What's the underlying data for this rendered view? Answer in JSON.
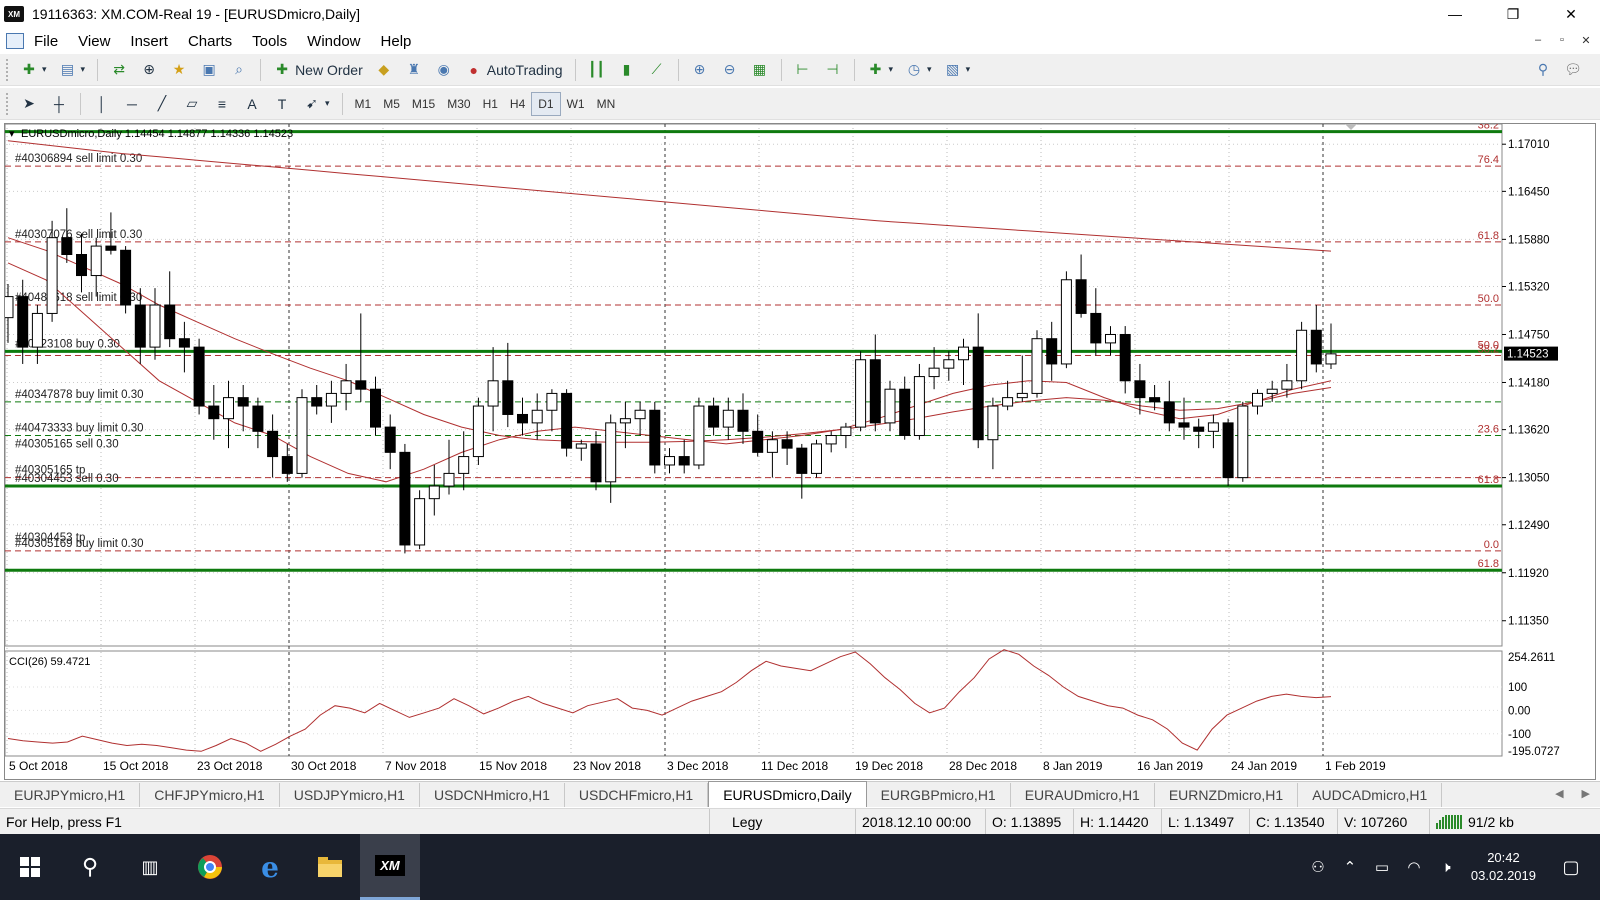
{
  "window": {
    "logo": "XM",
    "title": "19116363: XM.COM-Real 19 - [EURUSDmicro,Daily]",
    "minimize": "—",
    "maximize": "❐",
    "close": "✕"
  },
  "menu": {
    "items": [
      "File",
      "View",
      "Insert",
      "Charts",
      "Tools",
      "Window",
      "Help"
    ],
    "mdi": [
      "–",
      "▫",
      "✕"
    ]
  },
  "toolbar": {
    "new_order": "New Order",
    "autotrading": "AutoTrading",
    "timeframes": [
      "M1",
      "M5",
      "M15",
      "M30",
      "H1",
      "H4",
      "D1",
      "W1",
      "MN"
    ],
    "active_timeframe": "D1"
  },
  "chart": {
    "header": "EURUSDmicro,Daily  1.14454 1.14877 1.14336 1.14523",
    "price_ticks": [
      "1.17010",
      "1.16450",
      "1.15880",
      "1.15320",
      "1.14750",
      "1.14180",
      "1.13620",
      "1.13050",
      "1.12490",
      "1.11920",
      "1.11350"
    ],
    "current_price": "1.14523",
    "dates": [
      "5 Oct 2018",
      "15 Oct 2018",
      "23 Oct 2018",
      "30 Oct 2018",
      "7 Nov 2018",
      "15 Nov 2018",
      "23 Nov 2018",
      "3 Dec 2018",
      "11 Dec 2018",
      "19 Dec 2018",
      "28 Dec 2018",
      "8 Jan 2019",
      "16 Jan 2019",
      "24 Jan 2019",
      "1 Feb 2019"
    ],
    "fib_labels": [
      "38.2",
      "76.4",
      "61.8",
      "50.0",
      "50.0",
      "38.2",
      "23.6",
      "61.8",
      "0.0",
      "61.8"
    ],
    "order_labels": [
      "#40306894 sell limit 0.30",
      "#40307076 sell limit 0.30",
      "#40485618 sell limit 0.30",
      "#40523108 buy 0.30",
      "#40347878 buy limit 0.30",
      "#40473333 buy limit 0.30",
      "#40305165 sell 0.30",
      "#40305165 tp",
      "#40304453 sell 0.30",
      "#40304453 tp",
      "#40305169 buy limit 0.30"
    ],
    "cci_label": "CCI(26) 59.4721",
    "cci_ticks": [
      "254.2611",
      "100",
      "0.00",
      "-100",
      "-195.0727"
    ]
  },
  "chart_data": {
    "type": "candlestick",
    "title": "EURUSDmicro,Daily",
    "ylim": [
      1.1105,
      1.1725
    ],
    "ohlc": [
      [
        1.1495,
        1.1535,
        1.1465,
        1.152
      ],
      [
        1.152,
        1.154,
        1.144,
        1.146
      ],
      [
        1.146,
        1.151,
        1.144,
        1.15
      ],
      [
        1.15,
        1.161,
        1.149,
        1.159
      ],
      [
        1.159,
        1.1625,
        1.156,
        1.157
      ],
      [
        1.157,
        1.1595,
        1.1525,
        1.1545
      ],
      [
        1.1545,
        1.159,
        1.152,
        1.158
      ],
      [
        1.158,
        1.162,
        1.157,
        1.1575
      ],
      [
        1.1575,
        1.158,
        1.15,
        1.151
      ],
      [
        1.151,
        1.153,
        1.144,
        1.146
      ],
      [
        1.146,
        1.153,
        1.1445,
        1.151
      ],
      [
        1.151,
        1.155,
        1.146,
        1.147
      ],
      [
        1.147,
        1.149,
        1.143,
        1.146
      ],
      [
        1.146,
        1.147,
        1.138,
        1.139
      ],
      [
        1.139,
        1.1415,
        1.135,
        1.1375
      ],
      [
        1.1375,
        1.142,
        1.134,
        1.14
      ],
      [
        1.14,
        1.1415,
        1.136,
        1.139
      ],
      [
        1.139,
        1.14,
        1.134,
        1.136
      ],
      [
        1.136,
        1.138,
        1.1305,
        1.133
      ],
      [
        1.133,
        1.1345,
        1.13,
        1.131
      ],
      [
        1.131,
        1.141,
        1.1305,
        1.14
      ],
      [
        1.14,
        1.1415,
        1.138,
        1.139
      ],
      [
        1.139,
        1.142,
        1.137,
        1.1405
      ],
      [
        1.1405,
        1.144,
        1.1385,
        1.142
      ],
      [
        1.142,
        1.15,
        1.1395,
        1.141
      ],
      [
        1.141,
        1.1425,
        1.1355,
        1.1365
      ],
      [
        1.1365,
        1.138,
        1.1315,
        1.1335
      ],
      [
        1.1335,
        1.1345,
        1.1215,
        1.1225
      ],
      [
        1.1225,
        1.129,
        1.122,
        1.128
      ],
      [
        1.128,
        1.132,
        1.126,
        1.1295
      ],
      [
        1.1295,
        1.135,
        1.1285,
        1.131
      ],
      [
        1.131,
        1.136,
        1.129,
        1.133
      ],
      [
        1.133,
        1.14,
        1.132,
        1.139
      ],
      [
        1.139,
        1.146,
        1.136,
        1.142
      ],
      [
        1.142,
        1.1465,
        1.1365,
        1.138
      ],
      [
        1.138,
        1.14,
        1.1355,
        1.137
      ],
      [
        1.137,
        1.1405,
        1.135,
        1.1385
      ],
      [
        1.1385,
        1.141,
        1.136,
        1.1405
      ],
      [
        1.1405,
        1.141,
        1.133,
        1.134
      ],
      [
        1.134,
        1.135,
        1.1325,
        1.1345
      ],
      [
        1.1345,
        1.136,
        1.129,
        1.13
      ],
      [
        1.13,
        1.138,
        1.1275,
        1.137
      ],
      [
        1.137,
        1.1395,
        1.134,
        1.1375
      ],
      [
        1.1375,
        1.1395,
        1.1355,
        1.1385
      ],
      [
        1.1385,
        1.1395,
        1.131,
        1.132
      ],
      [
        1.132,
        1.134,
        1.131,
        1.133
      ],
      [
        1.133,
        1.135,
        1.131,
        1.132
      ],
      [
        1.132,
        1.14,
        1.1315,
        1.139
      ],
      [
        1.139,
        1.14,
        1.1355,
        1.1365
      ],
      [
        1.1365,
        1.14,
        1.135,
        1.1385
      ],
      [
        1.1385,
        1.1405,
        1.1345,
        1.136
      ],
      [
        1.136,
        1.138,
        1.133,
        1.1335
      ],
      [
        1.1335,
        1.136,
        1.1305,
        1.135
      ],
      [
        1.135,
        1.136,
        1.132,
        1.134
      ],
      [
        1.134,
        1.1345,
        1.128,
        1.131
      ],
      [
        1.131,
        1.135,
        1.1305,
        1.1345
      ],
      [
        1.1345,
        1.136,
        1.1335,
        1.1355
      ],
      [
        1.1355,
        1.137,
        1.134,
        1.1365
      ],
      [
        1.1365,
        1.1455,
        1.136,
        1.1445
      ],
      [
        1.1445,
        1.1475,
        1.136,
        1.137
      ],
      [
        1.137,
        1.142,
        1.136,
        1.141
      ],
      [
        1.141,
        1.1425,
        1.135,
        1.1355
      ],
      [
        1.1355,
        1.144,
        1.135,
        1.1425
      ],
      [
        1.1425,
        1.146,
        1.141,
        1.1435
      ],
      [
        1.1435,
        1.1455,
        1.142,
        1.1445
      ],
      [
        1.1445,
        1.147,
        1.1415,
        1.146
      ],
      [
        1.146,
        1.15,
        1.134,
        1.135
      ],
      [
        1.135,
        1.14,
        1.1315,
        1.139
      ],
      [
        1.139,
        1.142,
        1.1385,
        1.14
      ],
      [
        1.14,
        1.145,
        1.1395,
        1.1405
      ],
      [
        1.1405,
        1.148,
        1.14,
        1.147
      ],
      [
        1.147,
        1.149,
        1.142,
        1.144
      ],
      [
        1.144,
        1.155,
        1.1435,
        1.154
      ],
      [
        1.154,
        1.157,
        1.1495,
        1.15
      ],
      [
        1.15,
        1.153,
        1.145,
        1.1465
      ],
      [
        1.1465,
        1.1485,
        1.145,
        1.1475
      ],
      [
        1.1475,
        1.1485,
        1.1405,
        1.142
      ],
      [
        1.142,
        1.144,
        1.138,
        1.14
      ],
      [
        1.14,
        1.1415,
        1.1385,
        1.1395
      ],
      [
        1.1395,
        1.142,
        1.136,
        1.137
      ],
      [
        1.137,
        1.14,
        1.135,
        1.1365
      ],
      [
        1.1365,
        1.1375,
        1.134,
        1.136
      ],
      [
        1.136,
        1.138,
        1.134,
        1.137
      ],
      [
        1.137,
        1.1375,
        1.1295,
        1.1305
      ],
      [
        1.1305,
        1.1395,
        1.13,
        1.139
      ],
      [
        1.139,
        1.141,
        1.138,
        1.1405
      ],
      [
        1.1405,
        1.142,
        1.1395,
        1.141
      ],
      [
        1.141,
        1.144,
        1.14,
        1.142
      ],
      [
        1.142,
        1.149,
        1.141,
        1.148
      ],
      [
        1.148,
        1.151,
        1.143,
        1.144
      ],
      [
        1.144,
        1.1488,
        1.1434,
        1.1452
      ]
    ],
    "series": [
      {
        "name": "MA slow",
        "color": "#b03030",
        "values": [
          1.1705,
          1.17,
          1.1695,
          1.169,
          1.1686,
          1.1682,
          1.1678,
          1.1674,
          1.167,
          1.1666,
          1.1662,
          1.1658,
          1.1654,
          1.165,
          1.1646,
          1.1642,
          1.1638,
          1.1634,
          1.163,
          1.1626,
          1.1622,
          1.1618,
          1.1614,
          1.161,
          1.1607,
          1.1604,
          1.1601,
          1.1598,
          1.1595,
          1.1592,
          1.1589,
          1.1586,
          1.1583,
          1.158,
          1.1577,
          1.1574
        ]
      },
      {
        "name": "MA medium",
        "color": "#b03030",
        "values": [
          1.159,
          1.1575,
          1.1555,
          1.1535,
          1.151,
          1.149,
          1.147,
          1.1452,
          1.1435,
          1.142,
          1.14,
          1.138,
          1.1365,
          1.1355,
          1.135,
          1.1348,
          1.1347,
          1.1347,
          1.1348,
          1.135,
          1.1353,
          1.1357,
          1.1362,
          1.1368,
          1.1375,
          1.1383,
          1.139,
          1.1396,
          1.14,
          1.1397,
          1.139,
          1.1385,
          1.1387,
          1.1395,
          1.1405,
          1.1412
        ]
      },
      {
        "name": "MA fast",
        "color": "#b03030",
        "values": [
          1.156,
          1.154,
          1.15,
          1.146,
          1.142,
          1.1395,
          1.137,
          1.1355,
          1.133,
          1.131,
          1.13,
          1.1315,
          1.1335,
          1.135,
          1.136,
          1.1365,
          1.136,
          1.1355,
          1.135,
          1.1345,
          1.135,
          1.1355,
          1.1362,
          1.1375,
          1.139,
          1.1405,
          1.1415,
          1.142,
          1.1418,
          1.14,
          1.1385,
          1.1375,
          1.138,
          1.1395,
          1.141,
          1.142
        ]
      }
    ],
    "levels": [
      {
        "price": 1.1716,
        "color": "#0e7a0e",
        "fib": "38.2",
        "order": ""
      },
      {
        "price": 1.1675,
        "color": "#b03030",
        "fib": "76.4",
        "order": "#40306894 sell limit 0.30"
      },
      {
        "price": 1.1585,
        "color": "#b03030",
        "fib": "61.8",
        "order": "#40307076 sell limit 0.30"
      },
      {
        "price": 1.151,
        "color": "#b03030",
        "fib": "50.0",
        "order": "#40485618 sell limit 0.30"
      },
      {
        "price": 1.1455,
        "color": "#0e7a0e",
        "fib": "50.0",
        "order": "#40523108 buy 0.30"
      },
      {
        "price": 1.145,
        "color": "#b03030",
        "fib": "38.2",
        "order": ""
      },
      {
        "price": 1.1395,
        "color": "#0e7a0e",
        "fib": "",
        "order": "#40347878 buy limit 0.30"
      },
      {
        "price": 1.1355,
        "color": "#0e7a0e",
        "fib": "23.6",
        "order": "#40473333 buy limit 0.30"
      },
      {
        "price": 1.1305,
        "color": "#b03030",
        "fib": "",
        "order": "#40305165 tp"
      },
      {
        "price": 1.1295,
        "color": "#0e7a0e",
        "fib": "61.8",
        "order": "#40304453 sell 0.30"
      },
      {
        "price": 1.1218,
        "color": "#b03030",
        "fib": "0.0",
        "order": "#40305169 buy limit 0.30"
      },
      {
        "price": 1.1195,
        "color": "#0e7a0e",
        "fib": "61.8",
        "order": ""
      }
    ],
    "cci": {
      "ylim": [
        -195.0727,
        254.2611
      ],
      "values": [
        -120,
        -130,
        -135,
        -140,
        -135,
        -110,
        -125,
        -140,
        -150,
        -145,
        -150,
        -160,
        -170,
        -175,
        -150,
        -120,
        -140,
        -175,
        -145,
        -110,
        -80,
        -20,
        20,
        10,
        -10,
        30,
        0,
        -30,
        -10,
        10,
        50,
        20,
        -15,
        10,
        40,
        60,
        30,
        10,
        -10,
        20,
        35,
        50,
        10,
        0,
        -20,
        10,
        40,
        60,
        80,
        120,
        170,
        210,
        190,
        180,
        170,
        200,
        230,
        250,
        200,
        140,
        90,
        30,
        -10,
        10,
        80,
        140,
        220,
        260,
        240,
        190,
        150,
        100,
        60,
        40,
        20,
        10,
        -20,
        -40,
        -80,
        -140,
        -170,
        -80,
        -20,
        10,
        40,
        60,
        70,
        60,
        55,
        59
      ]
    }
  },
  "tabs": {
    "items": [
      "EURJPYmicro,H1",
      "CHFJPYmicro,H1",
      "USDJPYmicro,H1",
      "USDCNHmicro,H1",
      "USDCHFmicro,H1",
      "EURUSDmicro,Daily",
      "EURGBPmicro,H1",
      "EURAUDmicro,H1",
      "EURNZDmicro,H1",
      "AUDCADmicro,H1"
    ],
    "active": "EURUSDmicro,Daily"
  },
  "status": {
    "help": "For Help, press F1",
    "profile": "Legy",
    "time": "2018.12.10 00:00",
    "open": "O: 1.13895",
    "high": "H: 1.14420",
    "low": "L: 1.13497",
    "close": "C: 1.13540",
    "volume": "V: 107260",
    "traffic": "91/2 kb"
  },
  "taskbar": {
    "time": "20:42",
    "date": "03.02.2019",
    "app_label": "XM"
  }
}
